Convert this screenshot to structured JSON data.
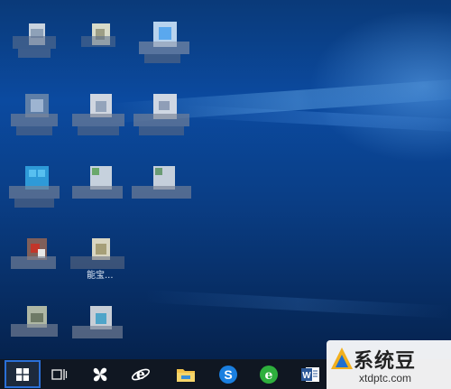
{
  "desktop": {
    "visible_label": "能宝..."
  },
  "taskbar": {
    "items": [
      {
        "name": "start-button",
        "icon": "windows-logo-icon"
      },
      {
        "name": "task-view",
        "icon": "task-view-icon"
      },
      {
        "name": "pinned-app-1",
        "icon": "pinwheel-icon"
      },
      {
        "name": "internet-explorer",
        "icon": "ie-icon"
      },
      {
        "name": "file-explorer",
        "icon": "folder-icon"
      },
      {
        "name": "sogou-browser",
        "icon": "s-browser-icon"
      },
      {
        "name": "360-browser",
        "icon": "green-e-icon"
      },
      {
        "name": "word",
        "icon": "word-icon"
      }
    ]
  },
  "watermark": {
    "title": "系统豆",
    "url": "xtdptc.com"
  },
  "colors": {
    "accent": "#2a6fd6",
    "taskbar": "#101722",
    "desktop": "#0b4aa0"
  }
}
